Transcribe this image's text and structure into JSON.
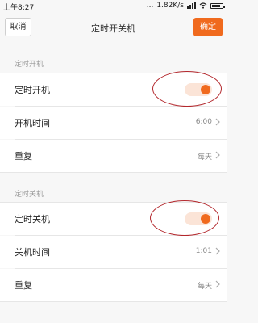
{
  "status": {
    "time": "上午8:27",
    "dots": "...",
    "speed": "1.82K/s",
    "battery_level": 0.8
  },
  "nav": {
    "cancel_label": "取消",
    "title": "定时开关机",
    "ok_label": "确定"
  },
  "power_on": {
    "section_title": "定时开机",
    "toggle_label": "定时开机",
    "toggle_on": true,
    "time_label": "开机时间",
    "time_value": "6:00",
    "repeat_label": "重复",
    "repeat_value": "每天"
  },
  "power_off": {
    "section_title": "定时关机",
    "toggle_label": "定时关机",
    "toggle_on": true,
    "time_label": "关机时间",
    "time_value": "1:01",
    "repeat_label": "重复",
    "repeat_value": "每天"
  },
  "colors": {
    "accent": "#f06a1e",
    "annotation": "#b3282d"
  }
}
